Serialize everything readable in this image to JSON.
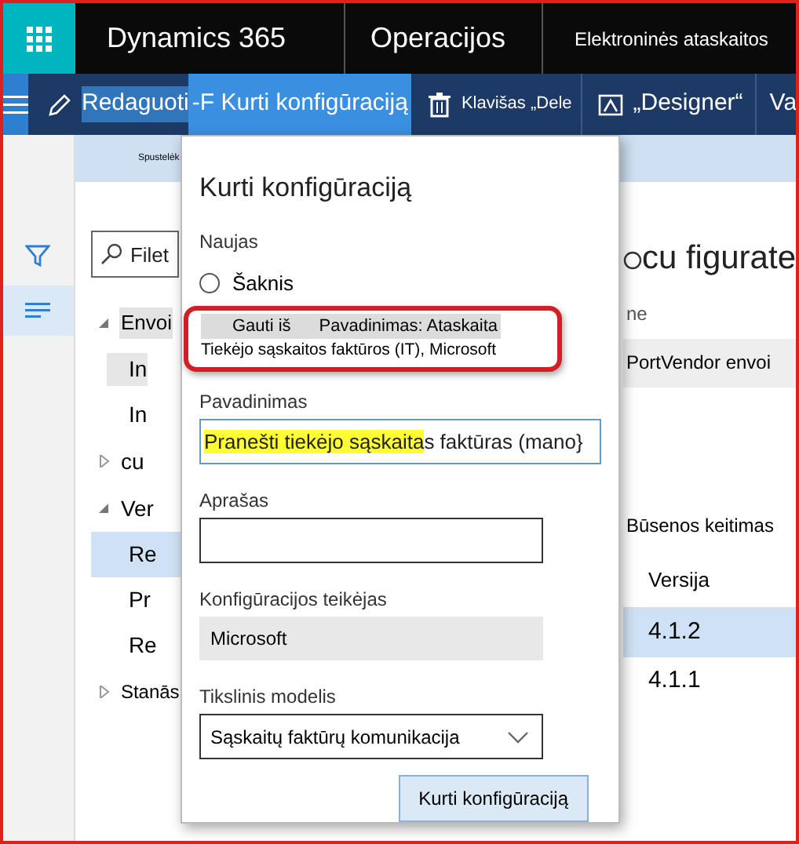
{
  "app_bar": {
    "title": "Dynamics 365",
    "module": "Operacijos",
    "page": "Elektroninės ataskaitos"
  },
  "action_bar": {
    "items": [
      {
        "kind": "edit",
        "label": "Redaguoti",
        "selected": false
      },
      {
        "kind": "text",
        "label": "-F Kurti konfigūraciją",
        "selected": true
      },
      {
        "kind": "delete",
        "label": "Klavišas „Dele",
        "selected": false
      },
      {
        "kind": "designer",
        "label": "„Designer“",
        "selected": false
      },
      {
        "kind": "text",
        "label": "Va",
        "selected": false
      }
    ]
  },
  "strip": {
    "text": "Spustelėk"
  },
  "tree_panel": {
    "filter": {
      "placeholder": "Filet"
    },
    "items": [
      {
        "label": "Envoi",
        "expanded": true,
        "children": [
          {
            "label": "In",
            "selected": false
          },
          {
            "label": "In",
            "selected": false
          }
        ]
      },
      {
        "label": "cu",
        "expanded": false
      },
      {
        "label": "Ver",
        "expanded": true,
        "children": [
          {
            "label": "Re",
            "selected": true
          },
          {
            "label": "Pr",
            "selected": false
          },
          {
            "label": "Re",
            "selected": false
          }
        ]
      },
      {
        "label": "Stanās",
        "expanded": false
      }
    ]
  },
  "right_panel": {
    "title": "cu figurate",
    "column_1": "ne",
    "row": "PortVendor envoi",
    "section": "Būsenos keitimas",
    "version_column": "Versija",
    "versions": [
      {
        "label": "4.1.2",
        "selected": true
      },
      {
        "label": "4.1.1",
        "selected": false
      }
    ]
  },
  "dialog": {
    "title": "Kurti konfigūraciją",
    "new_label": "Naujas",
    "options": [
      {
        "kind": "simple",
        "label": "Šaknis",
        "selected": false
      },
      {
        "kind": "derive",
        "label": "Gauti iš",
        "name": "Pavadinimas: Ataskaita",
        "detail": "Tiekėjo sąskaitos faktūros (IT), Microsoft",
        "selected": true
      }
    ],
    "name_field": {
      "label": "Pavadinimas",
      "value_marked": "Pranešti tiekėjo sąskaita",
      "value_rest": "s faktūras (mano}"
    },
    "description_field": {
      "label": "Aprašas"
    },
    "provider_field": {
      "label": "Konfigūracijos teikėjas",
      "value": "Microsoft",
      "disabled": true
    },
    "model_field": {
      "label": "Tikslinis modelis",
      "value": "Sąskaitų faktūrų komunikacija"
    },
    "button": "Kurti konfigūraciją"
  }
}
